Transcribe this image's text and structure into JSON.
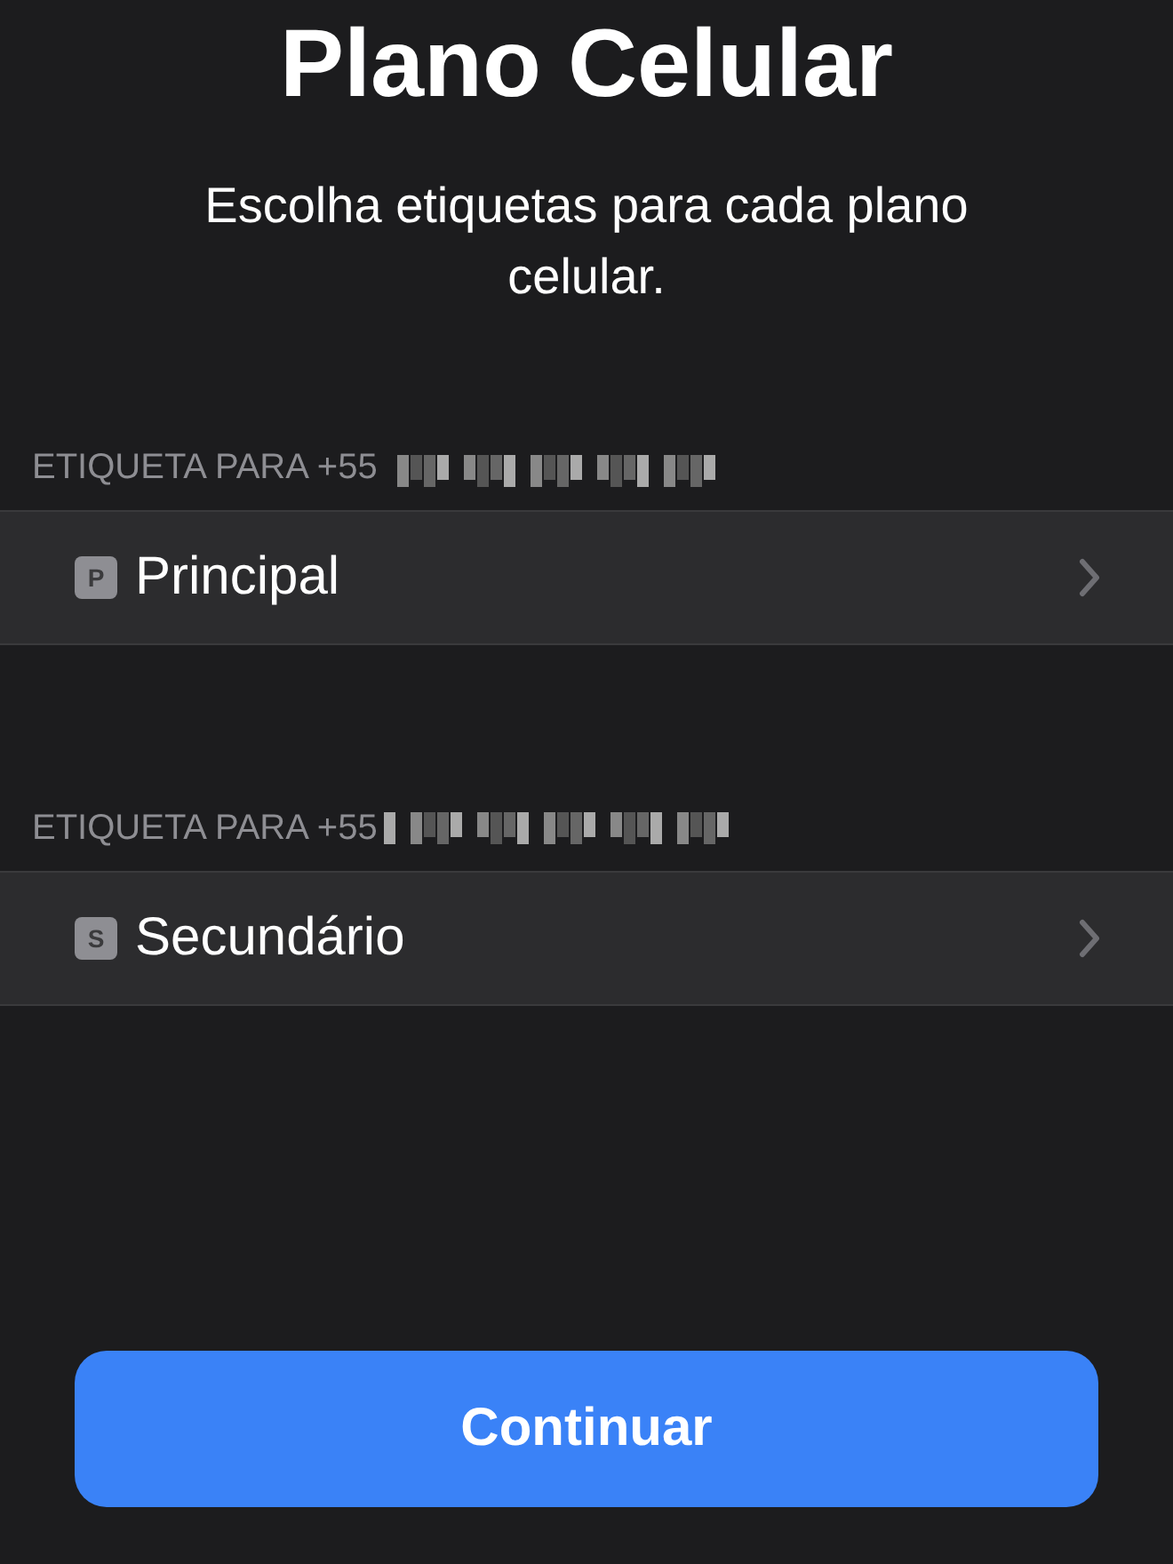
{
  "title": "Plano Celular",
  "subtitle": "Escolha etiquetas para cada plano celular.",
  "sections": [
    {
      "header": "ETIQUETA PARA +55",
      "label": {
        "badge": "P",
        "name": "Principal"
      }
    },
    {
      "header": "ETIQUETA PARA +55",
      "label": {
        "badge": "S",
        "name": "Secundário"
      }
    }
  ],
  "button": "Continuar"
}
